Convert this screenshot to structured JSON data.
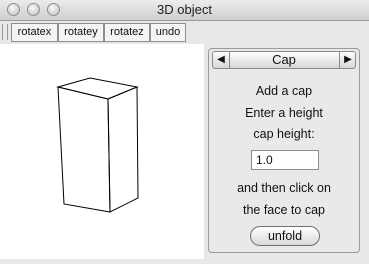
{
  "window": {
    "title": "3D object"
  },
  "toolbar": {
    "buttons": [
      "rotatex",
      "rotatey",
      "rotatez",
      "undo"
    ]
  },
  "panel": {
    "tab_label": "Cap",
    "lines": [
      "Add a cap",
      "Enter a height",
      "cap height:",
      "and then click on",
      "the face to cap"
    ],
    "input_value": "1.0",
    "button_label": "unfold"
  }
}
